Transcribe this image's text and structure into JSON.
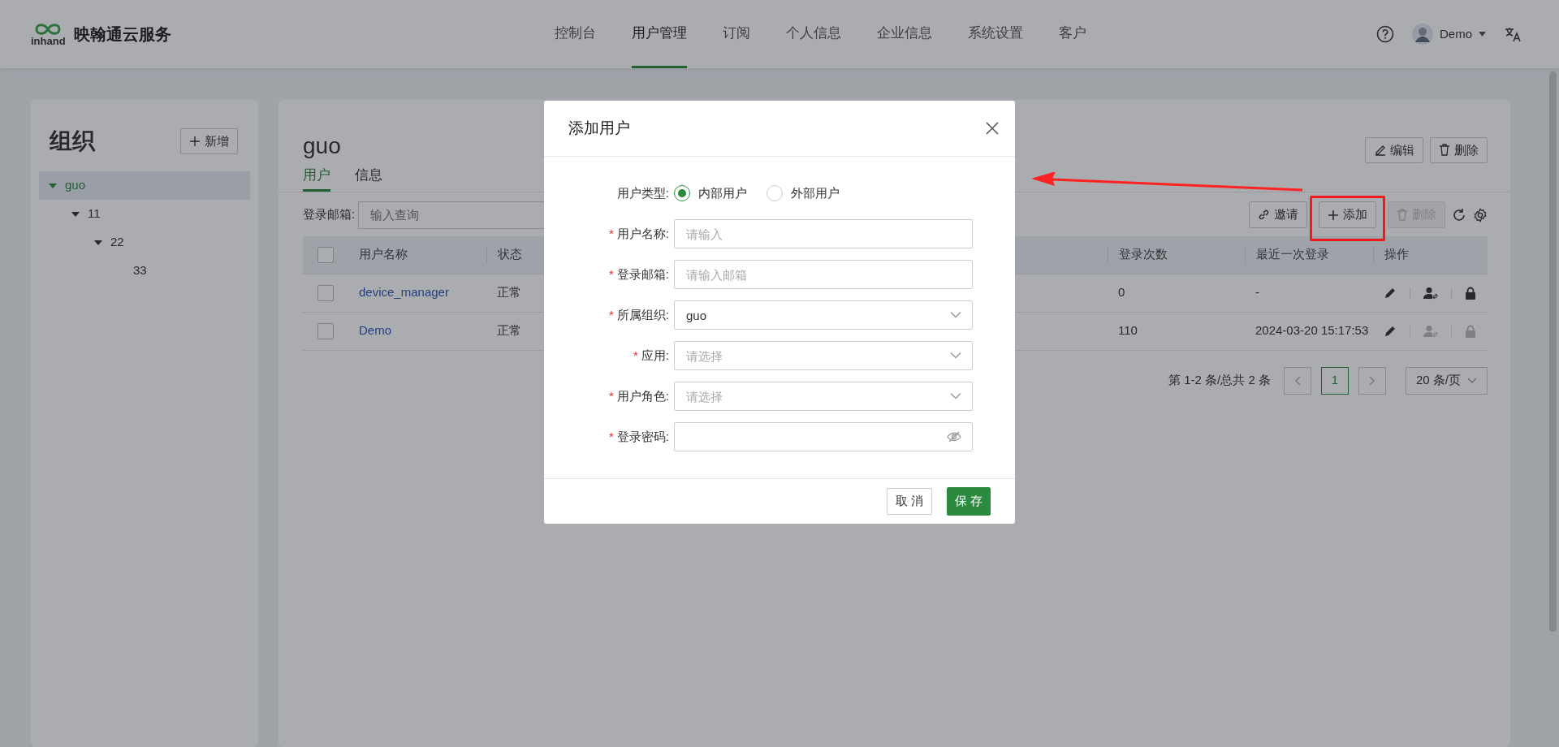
{
  "header": {
    "logo_text": "inhand",
    "brand": "映翰通云服务",
    "nav": [
      {
        "label": "控制台",
        "selected": false
      },
      {
        "label": "用户管理",
        "selected": true
      },
      {
        "label": "订阅",
        "selected": false
      },
      {
        "label": "个人信息",
        "selected": false
      },
      {
        "label": "企业信息",
        "selected": false
      },
      {
        "label": "系统设置",
        "selected": false
      },
      {
        "label": "客户",
        "selected": false
      }
    ],
    "user": "Demo"
  },
  "org_panel": {
    "title": "组织",
    "add_button": "新增",
    "tree": [
      {
        "label": "guo",
        "selected": true,
        "expanded": true,
        "children": [
          {
            "label": "11",
            "selected": false,
            "expanded": true,
            "children": [
              {
                "label": "22",
                "selected": false,
                "expanded": true,
                "children": [
                  {
                    "label": "33",
                    "selected": false
                  }
                ]
              }
            ]
          }
        ]
      }
    ]
  },
  "main": {
    "title": "guo",
    "edit_button": "编辑",
    "delete_button": "删除",
    "tabs": [
      {
        "label": "用户",
        "selected": true
      },
      {
        "label": "信息",
        "selected": false
      }
    ],
    "filter": {
      "label": "登录邮箱:",
      "placeholder": "输入查询"
    },
    "toolbar": {
      "invite": "邀请",
      "add": "添加",
      "delete": "删除",
      "delete_disabled": true,
      "add_highlighted": true
    },
    "table": {
      "select_all_checked": false,
      "columns": [
        "用户名称",
        "状态",
        "登录次数",
        "最近一次登录",
        "操作"
      ],
      "rows": [
        {
          "checked": false,
          "name": "device_manager",
          "status": "正常",
          "login_count": "0",
          "last_login": "-",
          "actions_disabled": false
        },
        {
          "checked": false,
          "name": "Demo",
          "status": "正常",
          "login_count": "110",
          "last_login": "2024-03-20 15:17:53",
          "actions_disabled": true
        }
      ]
    },
    "pagination": {
      "summary": "第 1-2 条/总共 2 条",
      "pages": [
        {
          "label": "1",
          "selected": true
        }
      ],
      "page_size": "20 条/页"
    }
  },
  "dialog": {
    "title": "添加用户",
    "required_mark": "*",
    "user_type": {
      "label": "用户类型:",
      "options": [
        {
          "label": "内部用户",
          "selected": true
        },
        {
          "label": "外部用户",
          "selected": false
        }
      ]
    },
    "fields": [
      {
        "label": "用户名称:",
        "required": true,
        "kind": "text",
        "placeholder": "请输入"
      },
      {
        "label": "登录邮箱:",
        "required": true,
        "kind": "text",
        "placeholder": "请输入邮箱"
      },
      {
        "label": "所属组织:",
        "required": true,
        "kind": "select",
        "value": "guo"
      },
      {
        "label": "应用:",
        "required": true,
        "kind": "select",
        "placeholder": "请选择"
      },
      {
        "label": "用户角色:",
        "required": true,
        "kind": "select",
        "placeholder": "请选择"
      },
      {
        "label": "登录密码:",
        "required": true,
        "kind": "password"
      }
    ],
    "cancel": "取 消",
    "save": "保 存"
  }
}
